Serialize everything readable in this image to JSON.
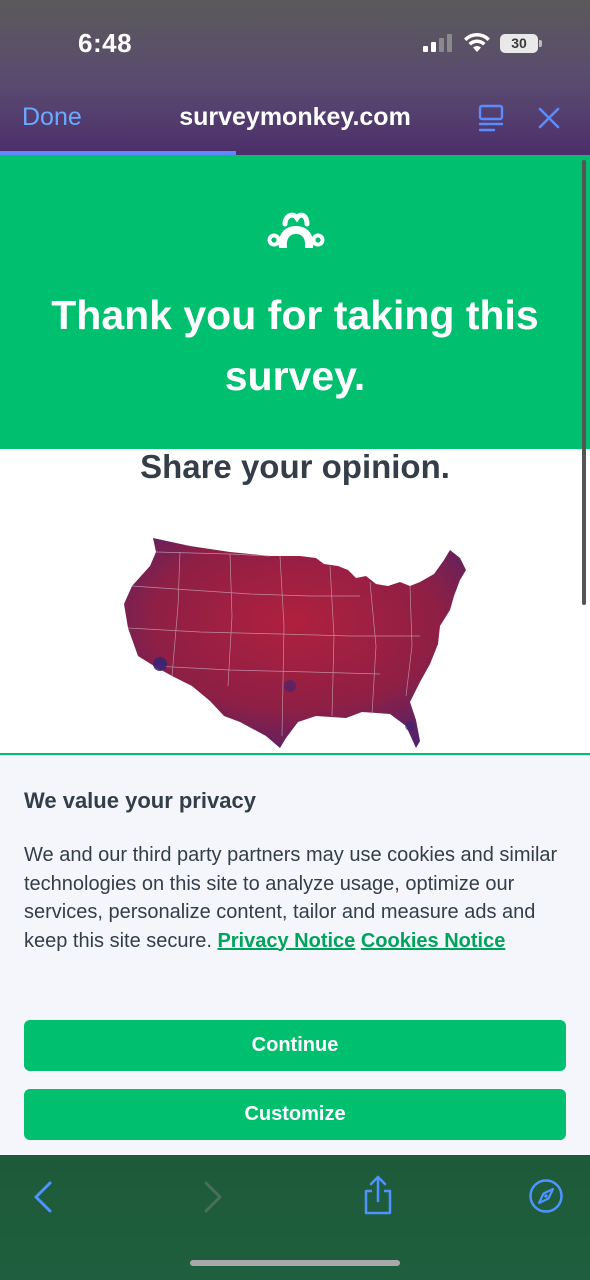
{
  "status_bar": {
    "time": "6:48",
    "battery": "30",
    "icons": [
      "signal-icon",
      "wifi-icon",
      "battery-icon"
    ]
  },
  "browser": {
    "done_label": "Done",
    "url": "surveymonkey.com",
    "icons": [
      "reader-icon",
      "close-icon"
    ],
    "load_progress": 0.4,
    "accent_color": "#6aa9ff"
  },
  "hero": {
    "logo": "surveymonkey-logo",
    "title": "Thank you for taking this survey.",
    "background": "#00bf6f"
  },
  "content": {
    "share_title": "Share your opinion.",
    "image": "us-map"
  },
  "privacy": {
    "title": "We value your privacy",
    "body": "We and our third party partners may use cookies and similar technologies on this site to analyze usage, optimize our services, personalize content, tailor and measure ads and keep this site secure.",
    "privacy_link": "Privacy Notice",
    "cookies_link": "Cookies Notice",
    "continue_label": "Continue",
    "customize_label": "Customize",
    "button_color": "#00bf6f"
  },
  "toolbar": {
    "icons": [
      "back-icon",
      "forward-icon",
      "share-icon",
      "compass-icon"
    ]
  }
}
